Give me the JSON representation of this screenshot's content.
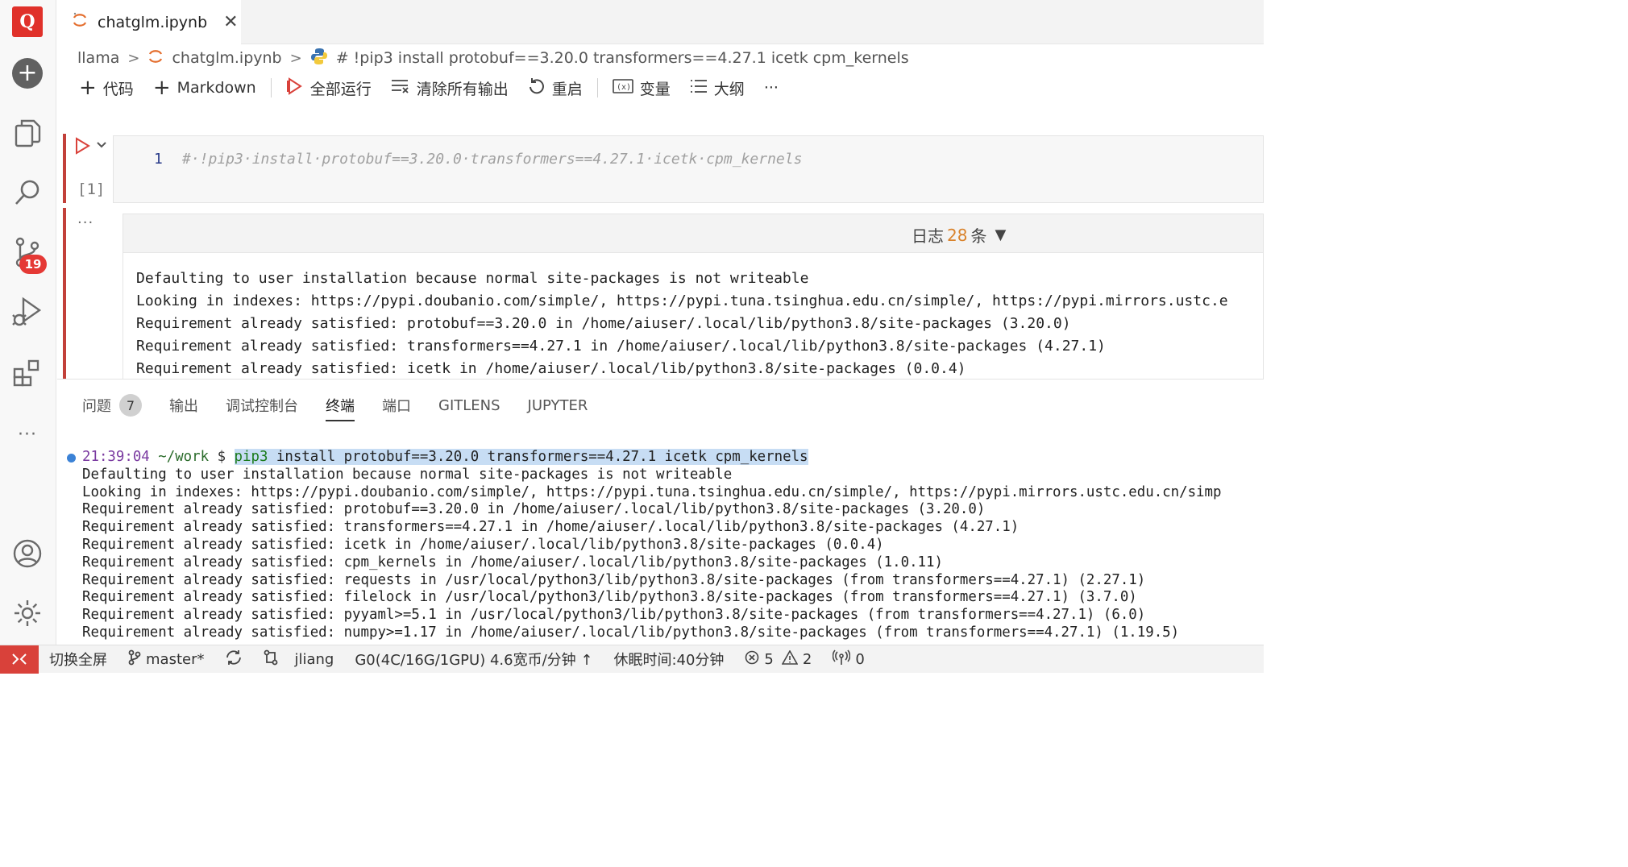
{
  "activity_bar": {
    "logo_letter": "Q",
    "source_control_badge": "19",
    "more_label": "···"
  },
  "tab": {
    "filename": "chatglm.ipynb",
    "close_symbol": "✕"
  },
  "breadcrumb": {
    "folder": "llama",
    "file": "chatglm.ipynb",
    "cell": "# !pip3 install protobuf==3.20.0 transformers==4.27.1 icetk cpm_kernels"
  },
  "toolbar": {
    "code": "代码",
    "markdown": "Markdown",
    "run_all": "全部运行",
    "clear_outputs": "清除所有输出",
    "restart": "重启",
    "variables": "变量",
    "outline": "大纲",
    "more": "···"
  },
  "cell": {
    "line_number": "1",
    "code": "#·!pip3·install·protobuf==3.20.0·transformers==4.27.1·icetk·cpm_kernels",
    "execution_count": "[1]",
    "output_menu": "···",
    "log_prefix": "日志",
    "log_count": "28",
    "log_suffix": "条",
    "log_toggle": "▼",
    "output_lines": [
      "Defaulting to user installation because normal site-packages is not writeable",
      "Looking in indexes: https://pypi.doubanio.com/simple/, https://pypi.tuna.tsinghua.edu.cn/simple/, https://pypi.mirrors.ustc.e",
      "Requirement already satisfied: protobuf==3.20.0 in /home/aiuser/.local/lib/python3.8/site-packages (3.20.0)",
      "Requirement already satisfied: transformers==4.27.1 in /home/aiuser/.local/lib/python3.8/site-packages (4.27.1)",
      "Requirement already satisfied: icetk in /home/aiuser/.local/lib/python3.8/site-packages (0.0.4)"
    ]
  },
  "panel": {
    "tabs": {
      "problems": "问题",
      "problems_count": "7",
      "output": "输出",
      "debug_console": "调试控制台",
      "terminal": "终端",
      "ports": "端口",
      "gitlens": "GITLENS",
      "jupyter": "JUPYTER"
    },
    "terminal": {
      "prompt_time": "21:39:04",
      "prompt_dir": "~/work",
      "prompt_symbol": "$",
      "command_keyword": "pip3",
      "command_rest": " install protobuf==3.20.0 transformers==4.27.1 icetk cpm_kernels",
      "lines": [
        "Defaulting to user installation because normal site-packages is not writeable",
        "Looking in indexes: https://pypi.doubanio.com/simple/, https://pypi.tuna.tsinghua.edu.cn/simple/, https://pypi.mirrors.ustc.edu.cn/simp",
        "Requirement already satisfied: protobuf==3.20.0 in /home/aiuser/.local/lib/python3.8/site-packages (3.20.0)",
        "Requirement already satisfied: transformers==4.27.1 in /home/aiuser/.local/lib/python3.8/site-packages (4.27.1)",
        "Requirement already satisfied: icetk in /home/aiuser/.local/lib/python3.8/site-packages (0.0.4)",
        "Requirement already satisfied: cpm_kernels in /home/aiuser/.local/lib/python3.8/site-packages (1.0.11)",
        "Requirement already satisfied: requests in /usr/local/python3/lib/python3.8/site-packages (from transformers==4.27.1) (2.27.1)",
        "Requirement already satisfied: filelock in /usr/local/python3/lib/python3.8/site-packages (from transformers==4.27.1) (3.7.0)",
        "Requirement already satisfied: pyyaml>=5.1 in /usr/local/python3/lib/python3.8/site-packages (from transformers==4.27.1) (6.0)",
        "Requirement already satisfied: numpy>=1.17 in /home/aiuser/.local/lib/python3.8/site-packages (from transformers==4.27.1) (1.19.5)"
      ]
    }
  },
  "statusbar": {
    "fullscreen": "切换全屏",
    "branch": "master*",
    "user": "jliang",
    "machine": "G0(4C/16G/1GPU) 4.6宽币/分钟 ↑",
    "sleep": "休眠时间:40分钟",
    "errors": "5",
    "warnings": "2",
    "ports": "0"
  },
  "colors": {
    "accent_red": "#d9413a",
    "log_count": "#d9822b",
    "selection": "#c7ddf4"
  }
}
